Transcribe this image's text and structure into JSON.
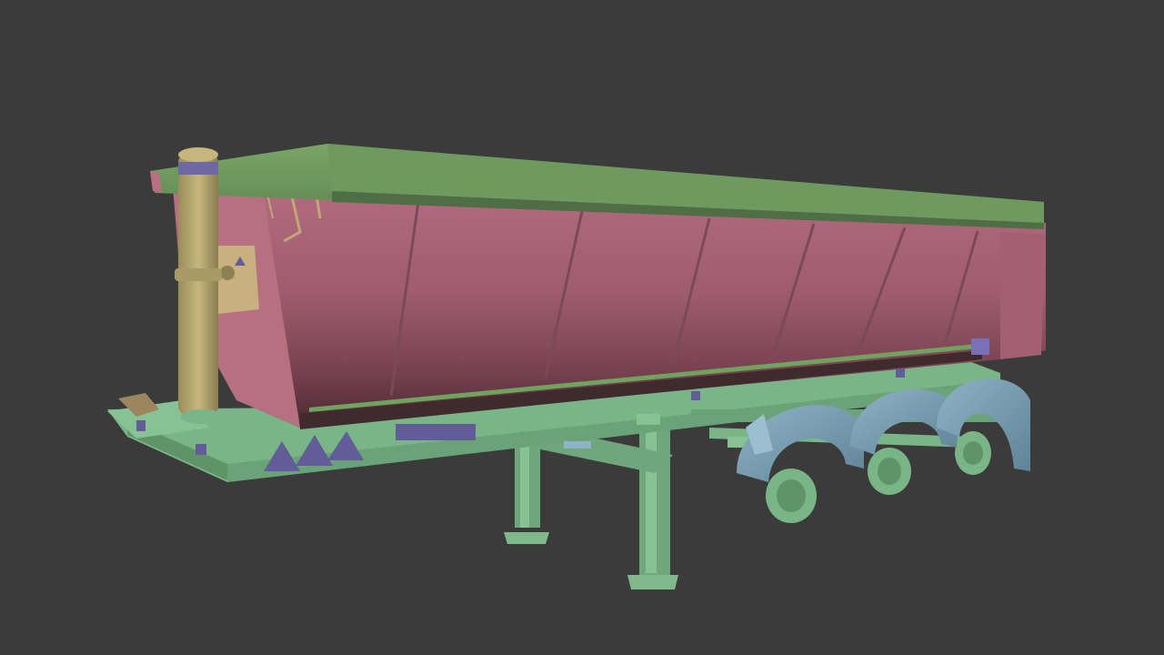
{
  "scene": {
    "subject": "semi-trailer-3d-model",
    "view": "3d-viewport-solid-shading",
    "colors": {
      "background": "#3b3b3b",
      "tarp": "#6f9a5f",
      "tarp_shadow": "#58794b",
      "body": "#a56274",
      "body_light": "#b86f83",
      "body_dark": "#7e4656",
      "body_darkest": "#4e2c35",
      "chassis": "#79b587",
      "chassis_dark": "#5f9468",
      "fender": "#7fa4b8",
      "fender_dark": "#5f8397",
      "pole": "#b8a870",
      "pole_dark": "#8d8052",
      "pole_band": "#6f68a6",
      "decal": "#625c98",
      "bracket": "#c9b080"
    }
  }
}
